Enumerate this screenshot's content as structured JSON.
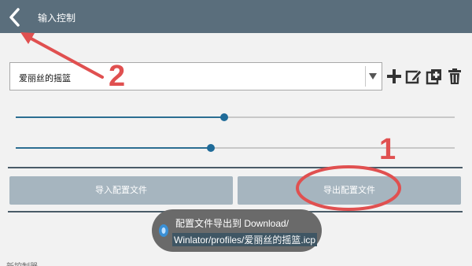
{
  "header": {
    "title": "输入控制",
    "back_icon": "back-arrow-icon"
  },
  "profile_select": {
    "value": "爱丽丝的摇篮",
    "caret_icon": "dropdown-caret-icon"
  },
  "toolbar": {
    "icons": [
      "add-icon",
      "edit-icon",
      "duplicate-icon",
      "delete-icon"
    ]
  },
  "sliders": [
    {
      "value": 0.475
    },
    {
      "value": 0.445
    }
  ],
  "buttons": {
    "import_label": "导入配置文件",
    "export_label": "导出配置文件"
  },
  "toast": {
    "line1": "配置文件导出到 Download/",
    "line2": "Winlator/profiles/爱丽丝的摇篮.icp"
  },
  "section": {
    "label": "新控制器"
  },
  "annotations": {
    "label_1": "1",
    "label_2": "2",
    "color": "#e05050"
  },
  "colors": {
    "topbar": "#5a6e7c",
    "accent": "#1f6b99",
    "button": "#a6b5bf"
  }
}
